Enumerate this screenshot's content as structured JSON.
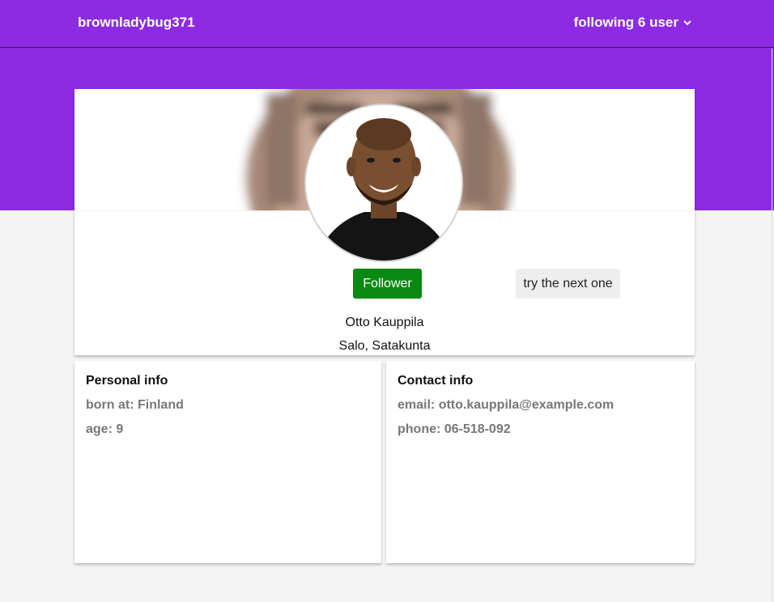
{
  "header": {
    "brand": "brownladybug371",
    "menu_label": "following 6 user"
  },
  "profile": {
    "follow_button_label": "Follower",
    "next_button_label": "try the next one",
    "name": "Otto Kauppila",
    "location": "Salo, Satakunta"
  },
  "personal_info": {
    "title": "Personal info",
    "born_at": "born at: Finland",
    "age": "age: 9"
  },
  "contact_info": {
    "title": "Contact info",
    "email": "email: otto.kauppila@example.com",
    "phone": "phone: 06-518-092"
  },
  "colors": {
    "header_background": "#8c2be2",
    "follow_button": "#0a8a12",
    "page_background": "#f4f4f4"
  },
  "icons": {
    "menu_dropdown": "chevron-down-icon"
  }
}
